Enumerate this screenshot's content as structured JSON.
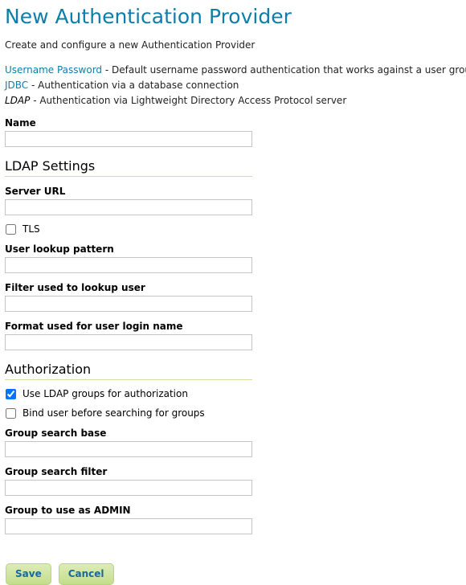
{
  "header": {
    "title": "New Authentication Provider",
    "subtitle": "Create and configure a new Authentication Provider"
  },
  "providers": [
    {
      "name": "Username Password",
      "type": "link",
      "separator": " - ",
      "description": "Default username password authentication that works against a user group service"
    },
    {
      "name": "JDBC",
      "type": "link",
      "separator": " - ",
      "description": "Authentication via a database connection"
    },
    {
      "name": "LDAP",
      "type": "current",
      "separator": " - ",
      "description": "Authentication via Lightweight Directory Access Protocol server"
    }
  ],
  "form": {
    "name": {
      "label": "Name",
      "value": "",
      "placeholder": ""
    },
    "ldap_settings": {
      "heading": "LDAP Settings",
      "server_url": {
        "label": "Server URL",
        "value": "",
        "placeholder": ""
      },
      "tls": {
        "label": "TLS",
        "checked": false
      },
      "user_lookup_pattern": {
        "label": "User lookup pattern",
        "value": "",
        "placeholder": ""
      },
      "filter_used_to_lookup_user": {
        "label": "Filter used to lookup user",
        "value": "",
        "placeholder": ""
      },
      "format_used_for_user_login_name": {
        "label": "Format used for user login name",
        "value": "",
        "placeholder": ""
      }
    },
    "authorization": {
      "heading": "Authorization",
      "use_ldap_groups": {
        "label": "Use LDAP groups for authorization",
        "checked": true
      },
      "bind_user_before_search": {
        "label": "Bind user before searching for groups",
        "checked": false
      },
      "group_search_base": {
        "label": "Group search base",
        "value": "",
        "placeholder": ""
      },
      "group_search_filter": {
        "label": "Group search filter",
        "value": "",
        "placeholder": ""
      },
      "group_to_use_as_admin": {
        "label": "Group to use as ADMIN",
        "value": "",
        "placeholder": ""
      }
    }
  },
  "buttons": {
    "save": "Save",
    "cancel": "Cancel"
  },
  "colors": {
    "title": "#0d7eab",
    "link": "#0d7eab",
    "section_rule": "#cfe0a3",
    "button_text": "#18699a",
    "button_bg": "#cfe49f",
    "input_border": "#c4c4c4"
  }
}
